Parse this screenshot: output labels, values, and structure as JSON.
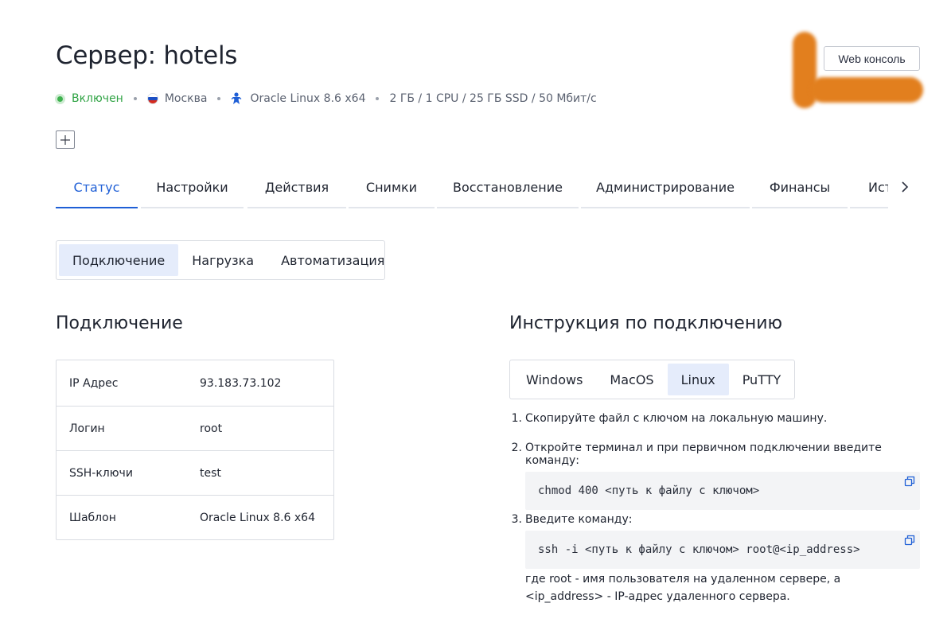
{
  "page": {
    "title": "Сервер: hotels"
  },
  "meta": {
    "status": "Включен",
    "location": "Москва",
    "os": "Oracle Linux 8.6 x64",
    "specs": "2 ГБ / 1 CPU / 25 ГБ SSD / 50 Мбит/с",
    "status_color": "#3fb24f"
  },
  "header_actions": {
    "web_console": "Web консоль"
  },
  "tabs": [
    {
      "label": "Статус",
      "active": true
    },
    {
      "label": "Настройки"
    },
    {
      "label": "Действия"
    },
    {
      "label": "Снимки"
    },
    {
      "label": "Восстановление"
    },
    {
      "label": "Администрирование"
    },
    {
      "label": "Финансы"
    },
    {
      "label": "История"
    }
  ],
  "subtabs": [
    {
      "label": "Подключение",
      "active": true
    },
    {
      "label": "Нагрузка"
    },
    {
      "label": "Автоматизация"
    }
  ],
  "connection": {
    "heading": "Подключение",
    "rows": [
      {
        "key": "IP Адрес",
        "value": "93.183.73.102"
      },
      {
        "key": "Логин",
        "value": "root"
      },
      {
        "key": "SSH-ключи",
        "value": "test"
      },
      {
        "key": "Шаблон",
        "value": "Oracle Linux 8.6 x64"
      }
    ]
  },
  "instructions": {
    "heading": "Инструкция по подключению",
    "os_tabs": [
      {
        "label": "Windows"
      },
      {
        "label": "MacOS"
      },
      {
        "label": "Linux",
        "active": true
      },
      {
        "label": "PuTTY"
      }
    ],
    "steps": [
      {
        "num": "1.",
        "text": "Скопируйте файл с ключом на локальную машину."
      },
      {
        "num": "2.",
        "text": "Откройте терминал и при первичном подключении введите команду:",
        "code": "chmod 400 <путь к файлу с ключом>"
      },
      {
        "num": "3.",
        "text": "Введите команду:",
        "code": "ssh -i <путь к файлу с ключом> root@<ip_address>"
      }
    ],
    "note": "где root - имя пользователя на удаленном сервере, а <ip_address> - IP-адрес удаленного сервера."
  },
  "colors": {
    "accent": "#1f5fd6",
    "active_bg": "#e5ecfb",
    "redaction": "#e27f1e"
  }
}
